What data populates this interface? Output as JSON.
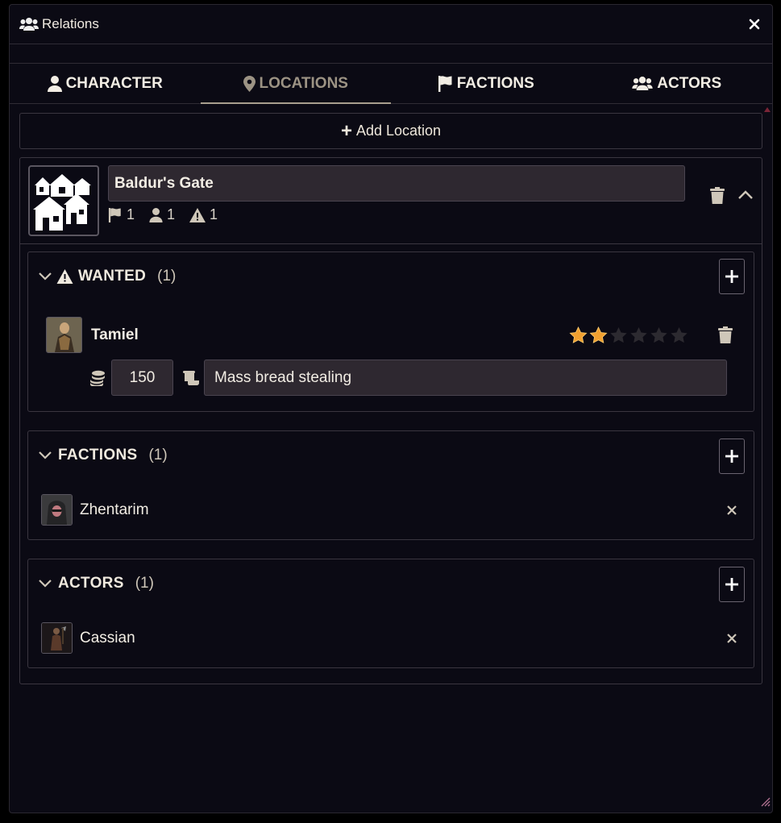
{
  "window": {
    "title": "Relations",
    "title_icon": "users-icon",
    "close_icon": "close-icon"
  },
  "tabs": [
    {
      "label": "CHARACTER",
      "icon": "user-icon",
      "active": false
    },
    {
      "label": "LOCATIONS",
      "icon": "map-marker-icon",
      "active": true
    },
    {
      "label": "FACTIONS",
      "icon": "flag-icon",
      "active": false
    },
    {
      "label": "ACTORS",
      "icon": "users-icon",
      "active": false
    }
  ],
  "add_location_label": "Add Location",
  "location": {
    "name": "Baldur's Gate",
    "image_icon": "town-icon",
    "stats": {
      "factions": "1",
      "actors": "1",
      "wanted": "1"
    }
  },
  "sections": {
    "wanted": {
      "title": "WANTED",
      "count": "(1)",
      "entries": [
        {
          "name": "Tamiel",
          "stars_filled": 2,
          "stars_total": 6,
          "bounty": "150",
          "reason": "Mass bread stealing"
        }
      ]
    },
    "factions": {
      "title": "FACTIONS",
      "count": "(1)",
      "entries": [
        {
          "name": "Zhentarim"
        }
      ]
    },
    "actors": {
      "title": "ACTORS",
      "count": "(1)",
      "entries": [
        {
          "name": "Cassian"
        }
      ]
    }
  },
  "colors": {
    "star_filled": "#f0a030",
    "star_empty": "#2c2a30",
    "background": "#0b0a14",
    "input_bg": "#2e2830"
  }
}
